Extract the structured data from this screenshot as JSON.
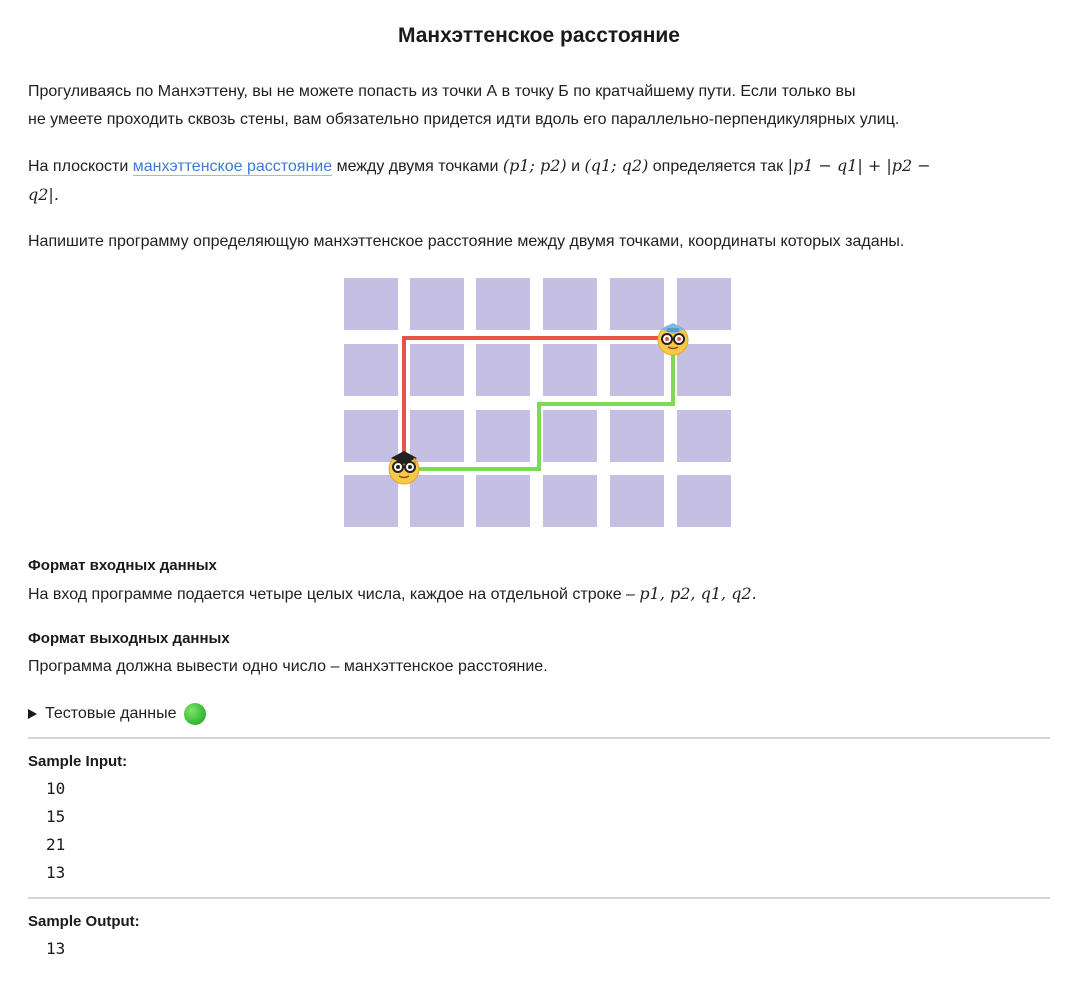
{
  "title": "Манхэттенское расстояние",
  "intro": {
    "line1": "Прогуливаясь по Манхэттену, вы не можете попасть из точки А в точку Б по кратчайшему пути. Если только вы",
    "line2": "не умеете проходить сквозь стены, вам обязательно придется идти вдоль его параллельно-перпендикулярных улиц."
  },
  "definition": {
    "prefix": "На плоскости ",
    "link_text": "манхэттенское расстояние",
    "middle": " между двумя точками ",
    "point1": "(p1; p2)",
    "and": " и ",
    "point2": "(q1; q2)",
    "tail": " определяется так ",
    "formula_line1": "|p1 − q1| + |p2 −",
    "formula_line2": "q2|."
  },
  "task": "Напишите программу определяющую манхэттенское расстояние между двумя точками, координаты которых заданы.",
  "figure": {
    "block_color": "#c5c0e3",
    "red_path_color": "#e8524a",
    "green_path_color": "#7ed957",
    "start_icon": "nerd-face-graduation-cap-icon",
    "end_icon": "nerd-face-blue-cap-icon"
  },
  "input_format": {
    "title": "Формат входных данных",
    "text": "На вход программе подается четыре целых числа, каждое на отдельной строке – ",
    "vars": "p1, p2, q1, q2."
  },
  "output_format": {
    "title": "Формат выходных данных",
    "text": "Программа должна вывести одно число – манхэттенское расстояние."
  },
  "test_data": {
    "label": "Тестовые данные",
    "status_icon": "green-circle-icon"
  },
  "sample_input": {
    "title": "Sample Input:",
    "lines": [
      "10",
      "15",
      "21",
      "13"
    ]
  },
  "sample_output": {
    "title": "Sample Output:",
    "lines": [
      "13"
    ]
  }
}
